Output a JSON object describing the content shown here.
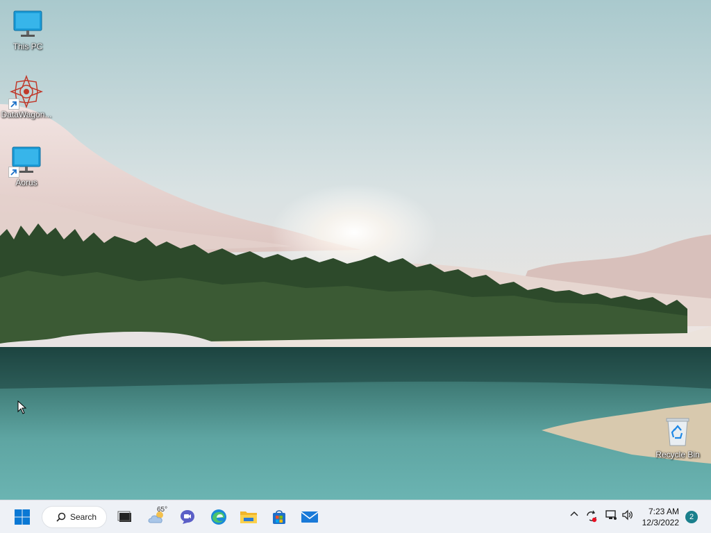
{
  "desktop": {
    "icons": [
      {
        "label": "This PC",
        "icon": "monitor-icon"
      },
      {
        "label": "DataWagon...",
        "icon": "datawagon-icon"
      },
      {
        "label": "Aorus",
        "icon": "monitor-icon"
      },
      {
        "label": "Recycle Bin",
        "icon": "recycle-bin-icon"
      }
    ]
  },
  "taskbar": {
    "search_label": "Search",
    "weather_temp": "65°",
    "clock_time": "7:23 AM",
    "clock_date": "12/3/2022",
    "notification_count": "2"
  },
  "colors": {
    "accent": "#0078d4",
    "taskbar_bg": "#eef1f6",
    "notification_badge": "#1a7f8c"
  }
}
